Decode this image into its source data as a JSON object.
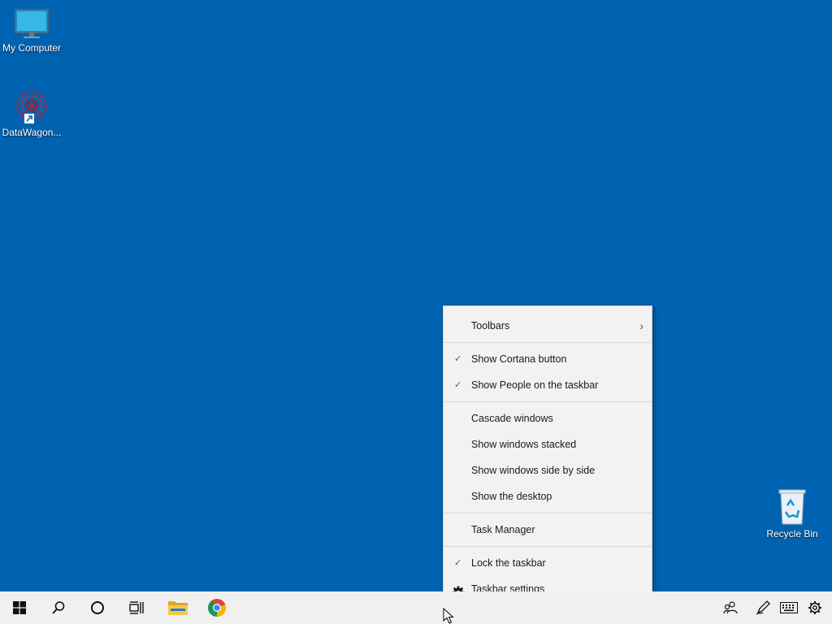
{
  "desktop": {
    "icons": {
      "my_computer": "My Computer",
      "datawagon": "DataWagon...",
      "recycle_bin": "Recycle Bin"
    }
  },
  "context_menu": {
    "toolbars": "Toolbars",
    "show_cortana": "Show Cortana button",
    "show_people": "Show People on the taskbar",
    "cascade": "Cascade windows",
    "stacked": "Show windows stacked",
    "side_by_side": "Show windows side by side",
    "show_desktop": "Show the desktop",
    "task_manager": "Task Manager",
    "lock_taskbar": "Lock the taskbar",
    "taskbar_settings": "Taskbar settings",
    "checked": {
      "show_cortana": true,
      "show_people": true,
      "lock_taskbar": true
    }
  },
  "taskbar": {
    "buttons": [
      "start-icon",
      "search-icon",
      "cortana-icon",
      "task-view-icon",
      "file-explorer-icon",
      "chrome-icon"
    ],
    "tray": [
      "people-icon",
      "pen-icon",
      "keyboard-icon",
      "settings-gear-icon"
    ]
  },
  "colors": {
    "desktop_bg": "#0063b1",
    "taskbar_bg": "#f0f0f0",
    "menu_bg": "#f2f2f2"
  }
}
